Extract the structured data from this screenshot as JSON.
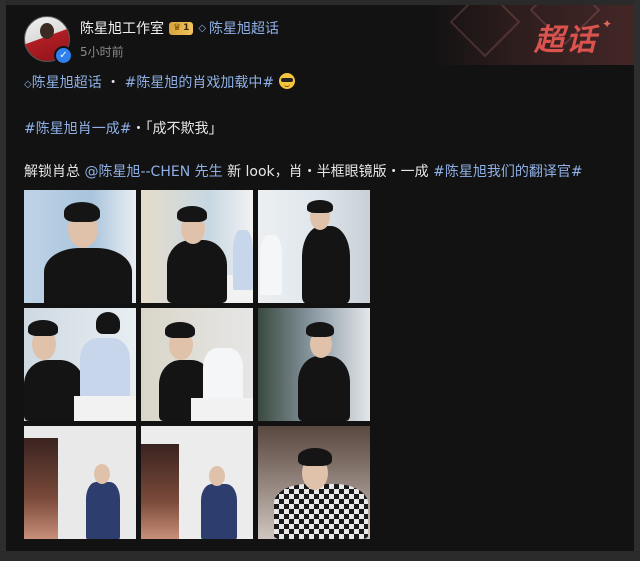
{
  "post": {
    "author": "陈星旭工作室",
    "level": "1",
    "topic_label": "陈星旭超话",
    "time": "5小时前",
    "banner_text": "超话"
  },
  "content": {
    "line1": {
      "topic": "陈星旭超话",
      "separator": " ・ ",
      "hashtag": "#陈星旭的肖戏加载中#"
    },
    "line2": {
      "hashtag": "#陈星旭肖一成#",
      "text": "・「成不欺我」"
    },
    "line3": {
      "prefix": "解锁肖总 ",
      "mention": "@陈星旭--CHEN 先生",
      "middle": " 新 look，肖・半框眼镜版・一成 ",
      "hashtag": "#陈星旭我们的翻译官#"
    }
  },
  "photos": [
    "photo-1",
    "photo-2",
    "photo-3",
    "photo-4",
    "photo-5",
    "photo-6",
    "photo-7",
    "photo-8",
    "photo-9"
  ],
  "icons": {
    "verified": "verified-check-icon",
    "level": "crown-level-icon",
    "topic": "diamond-icon",
    "emoji": "cool-sunglasses-emoji-icon"
  },
  "colors": {
    "background": "#121212",
    "link": "#8fb0e6",
    "banner_accent": "#d9534f",
    "badge_gold": "#e6b44c"
  }
}
